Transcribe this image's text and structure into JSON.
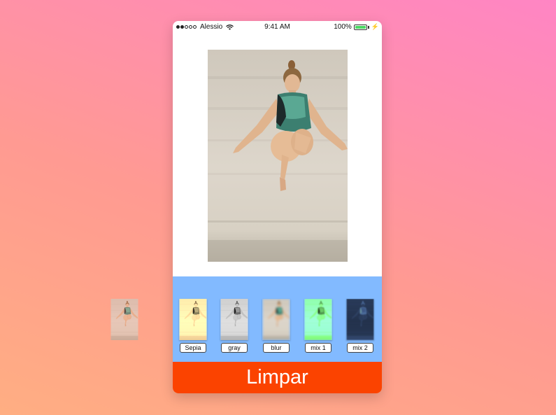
{
  "status_bar": {
    "carrier": "Alessio",
    "time": "9:41 AM",
    "battery": "100%",
    "battery_level": 1.0,
    "signal_bars_filled": 2,
    "signal_bars_total": 5
  },
  "filters": [
    {
      "label": "Sepia"
    },
    {
      "label": "gray"
    },
    {
      "label": "blur"
    },
    {
      "label": "mix 1"
    },
    {
      "label": "mix 2"
    }
  ],
  "clear_button": {
    "label": "Limpar"
  },
  "colors": {
    "filter_bar": "#82baff",
    "clear_button": "#fb4300",
    "battery": "#4cd964"
  },
  "icons": {
    "wifi": "wifi-icon",
    "battery": "battery-icon",
    "charging": "charging-bolt-icon"
  }
}
